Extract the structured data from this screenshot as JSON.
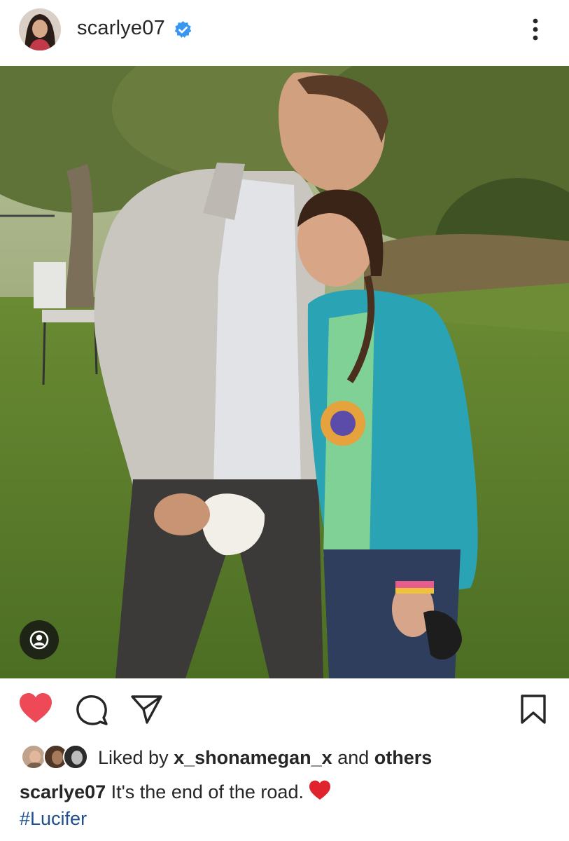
{
  "header": {
    "username": "scarlye07",
    "verified_icon": "verified-badge-icon",
    "more_icon": "more-vertical-icon"
  },
  "post": {
    "image_alt": "Photo of a man in a denim jacket and a girl in a teal hoodie outdoors under trees",
    "tag_icon": "user-tag-icon"
  },
  "actions": {
    "like_icon": "heart-filled-icon",
    "comment_icon": "comment-icon",
    "share_icon": "send-icon",
    "save_icon": "bookmark-icon"
  },
  "likes": {
    "prefix": "Liked by ",
    "user": "x_shonamegan_x",
    "middle": " and ",
    "suffix": "others"
  },
  "caption": {
    "username": "scarlye07",
    "text": " It's the end of the road.",
    "emoji": "heart-emoji"
  },
  "hashtag": "#Lucifer",
  "colors": {
    "like_red": "#ed4956",
    "verified_blue": "#3897f0",
    "hashtag_blue": "#1e4f8f"
  }
}
